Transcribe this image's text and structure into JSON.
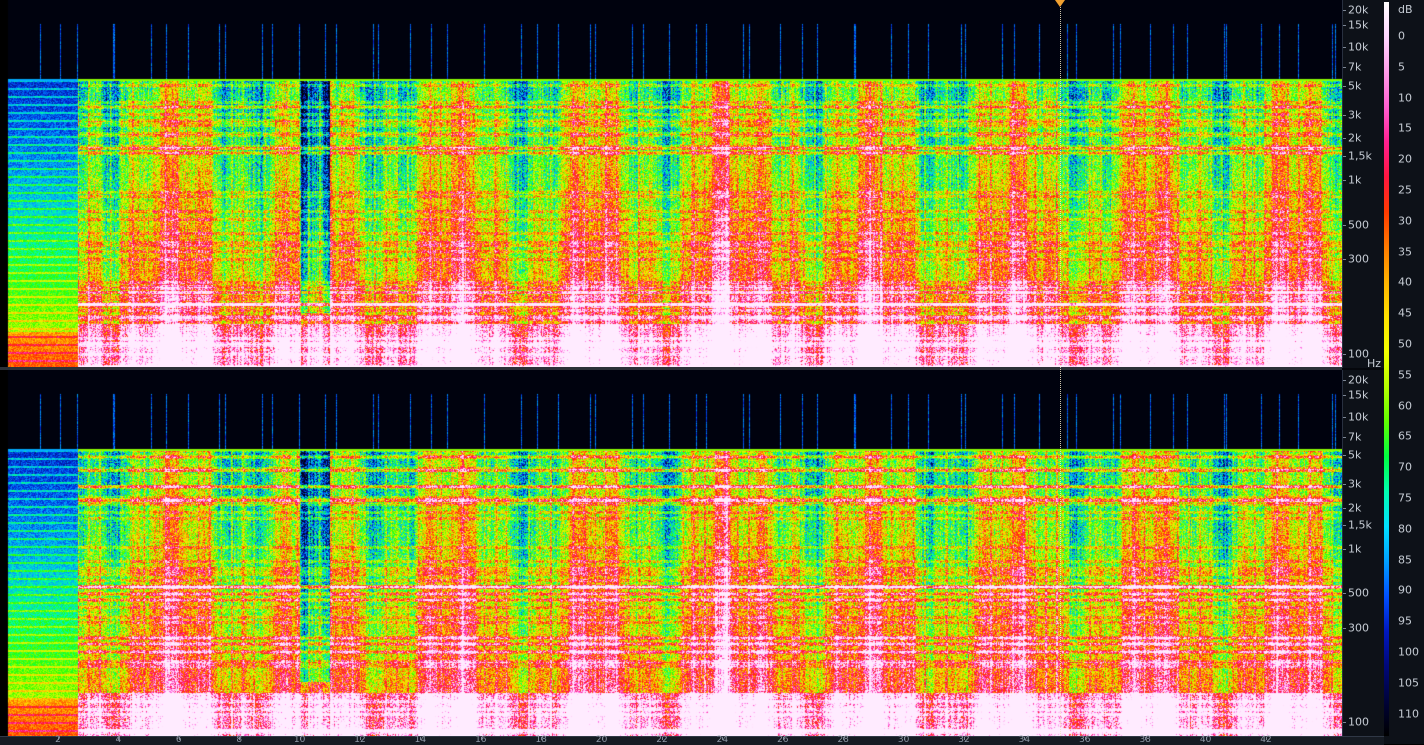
{
  "app": {
    "view": "spectrogram"
  },
  "frequency_axis": {
    "unit": "Hz",
    "labels": [
      {
        "text": "20k",
        "hz": 20000
      },
      {
        "text": "15k",
        "hz": 15000
      },
      {
        "text": "10k",
        "hz": 10000
      },
      {
        "text": "7k",
        "hz": 7000
      },
      {
        "text": "5k",
        "hz": 5000
      },
      {
        "text": "3k",
        "hz": 3000
      },
      {
        "text": "2k",
        "hz": 2000
      },
      {
        "text": "1,5k",
        "hz": 1500
      },
      {
        "text": "1k",
        "hz": 1000
      },
      {
        "text": "500",
        "hz": 500
      },
      {
        "text": "300",
        "hz": 300
      },
      {
        "text": "100",
        "hz": 100
      }
    ]
  },
  "db_scale": {
    "unit": "dB",
    "labels": [
      "0",
      "5",
      "10",
      "15",
      "20",
      "25",
      "30",
      "35",
      "40",
      "45",
      "50",
      "55",
      "60",
      "65",
      "70",
      "75",
      "80",
      "85",
      "90",
      "95",
      "100",
      "105",
      "110"
    ],
    "colors": [
      "#ffffff",
      "#ffd6ff",
      "#ff9be8",
      "#ff5fd0",
      "#ff2090",
      "#ff1640",
      "#ff3a00",
      "#ff7a00",
      "#ffb300",
      "#ffe000",
      "#f2ff00",
      "#b6ff00",
      "#60ff00",
      "#00ff40",
      "#00ffb0",
      "#00e0ff",
      "#00a0ff",
      "#0050ff",
      "#0018c0",
      "#00087a",
      "#00033a",
      "#000000"
    ]
  },
  "channels": [
    {
      "id": "left"
    },
    {
      "id": "right"
    }
  ],
  "playhead": {
    "time_fraction": 0.79
  },
  "time_ruler": {
    "labels": [
      "2",
      "4",
      "6",
      "8",
      "10",
      "12",
      "14",
      "16",
      "18",
      "20",
      "22",
      "24",
      "26",
      "28",
      "30",
      "32",
      "34",
      "36",
      "38",
      "40",
      "42"
    ]
  },
  "colors": {
    "background": "#000000",
    "panel": "#0d1118",
    "playhead_marker": "#f0a030"
  }
}
